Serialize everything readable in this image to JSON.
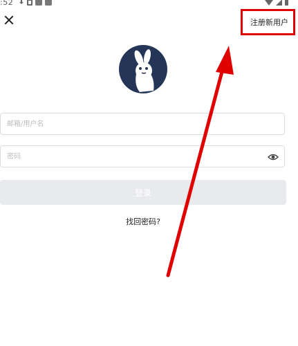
{
  "status_bar": {
    "time": ":52"
  },
  "header": {
    "register_label": "注册新用户"
  },
  "form": {
    "username_placeholder": "邮箱/用户名",
    "password_placeholder": "密码",
    "login_label": "登录",
    "forgot_label": "找回密码?"
  },
  "colors": {
    "highlight": "#e00000",
    "logo_bg": "#253557",
    "button_disabled_bg": "#e8eaee"
  },
  "icons": [
    "close-icon",
    "bunny-logo",
    "eye-icon"
  ]
}
